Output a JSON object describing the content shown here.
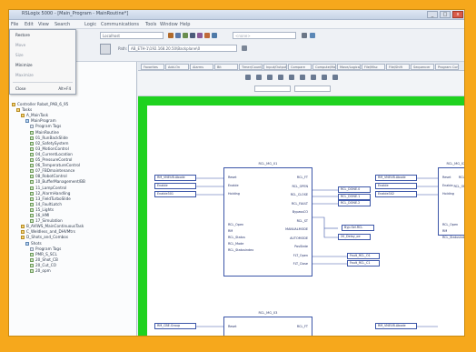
{
  "window": {
    "title": "RSLogix 5000 - [Main_Program - MainRoutine*]",
    "controls": [
      "_",
      "□",
      "x"
    ]
  },
  "menubar": {
    "items": [
      "File",
      "Edit",
      "View",
      "Search",
      "Logic",
      "Communications",
      "Tools",
      "Window",
      "Help"
    ]
  },
  "view_menu": {
    "items": [
      {
        "label": "Restore",
        "enabled": true
      },
      {
        "label": "Move",
        "enabled": false
      },
      {
        "label": "Size",
        "enabled": false
      },
      {
        "label": "Minimize",
        "enabled": true
      },
      {
        "label": "Maximize",
        "enabled": false
      },
      {
        "label": "Close",
        "enabled": true,
        "shortcut": "Alt+F4"
      }
    ]
  },
  "toolbar": {
    "combo_value": "Localhost",
    "path_value": "AB_ETH-1\\192.168.20.50\\Backplane\\0",
    "path_label": "Path:",
    "search_placeholder": "<none>"
  },
  "editor_tabs": [
    "Favorites",
    "Add-On",
    "Alarms",
    "Bit",
    "Timer/Counter",
    "Input/Output",
    "Compare",
    "Compute/Math",
    "Move/Logical",
    "File/Misc",
    "File/Shift",
    "Sequencer",
    "Program Control"
  ],
  "controller_organizer": {
    "items": [
      {
        "label": "Controller Robot_PAB_6_95",
        "indent": 0,
        "icon": "folder"
      },
      {
        "label": "Tasks",
        "indent": 1,
        "icon": "folder"
      },
      {
        "label": "A_MainTask",
        "indent": 2,
        "icon": "folder"
      },
      {
        "label": "MainProgram",
        "indent": 3,
        "icon": "prog"
      },
      {
        "label": "Program Tags",
        "indent": 4,
        "icon": "tag"
      },
      {
        "label": "MainRoutine",
        "indent": 4,
        "icon": "rout"
      },
      {
        "label": "01_RunBackSlide",
        "indent": 4,
        "icon": "rout"
      },
      {
        "label": "02_SafetySystem",
        "indent": 4,
        "icon": "rout"
      },
      {
        "label": "03_MotionControl",
        "indent": 4,
        "icon": "rout"
      },
      {
        "label": "04_CurrentLocation",
        "indent": 4,
        "icon": "rout"
      },
      {
        "label": "05_PressureControl",
        "indent": 4,
        "icon": "rout"
      },
      {
        "label": "06_TemperatureControl",
        "indent": 4,
        "icon": "rout"
      },
      {
        "label": "07_FBDmaintenance",
        "indent": 4,
        "icon": "rout"
      },
      {
        "label": "08_RobotControl",
        "indent": 4,
        "icon": "rout"
      },
      {
        "label": "10_BufferManagement/BB",
        "indent": 4,
        "icon": "rout"
      },
      {
        "label": "11_LampControl",
        "indent": 4,
        "icon": "rout"
      },
      {
        "label": "12_AlarmHandling",
        "indent": 4,
        "icon": "rout"
      },
      {
        "label": "13_FieldTurboSlide",
        "indent": 4,
        "icon": "rout"
      },
      {
        "label": "14_FaultLatch",
        "indent": 4,
        "icon": "rout"
      },
      {
        "label": "15_Lights",
        "indent": 4,
        "icon": "rout"
      },
      {
        "label": "16_HMI",
        "indent": 4,
        "icon": "rout"
      },
      {
        "label": "17_Simulation",
        "indent": 4,
        "icon": "rout"
      },
      {
        "label": "B_AVIWS_MainContinuousTask",
        "indent": 2,
        "icon": "folder"
      },
      {
        "label": "C_Weldless_and_DHVMtrs",
        "indent": 2,
        "icon": "folder"
      },
      {
        "label": "D_Shots_and_Combos",
        "indent": 2,
        "icon": "folder"
      },
      {
        "label": "Shots",
        "indent": 3,
        "icon": "prog"
      },
      {
        "label": "Program Tags",
        "indent": 4,
        "icon": "tag"
      },
      {
        "label": "PMR_S_SCL",
        "indent": 4,
        "icon": "rout"
      },
      {
        "label": "20_Shot_CB",
        "indent": 4,
        "icon": "rout"
      },
      {
        "label": "20_Cut_CO",
        "indent": 4,
        "icon": "rout"
      },
      {
        "label": "20_opm",
        "indent": 4,
        "icon": "rout"
      }
    ]
  },
  "fbd": {
    "blocks": [
      {
        "title": "RCL_MG_01",
        "inputs": [
          "Reset",
          "Enable",
          "Holding"
        ],
        "outputs": [
          "RCL_FT",
          "RCL_OPEN",
          "RCL_CLOSE",
          "RCL_FAULT",
          "BypassCO",
          "RCL_ST",
          "MANUALMODE",
          "AUTOMODE",
          "PosState",
          "FLT_Open",
          "FLT_Close"
        ],
        "left_params": [
          "RCL_Open",
          "RM",
          "RCL_Status",
          "RCL_Mode",
          "RCL_Statusindex"
        ]
      },
      {
        "title": "RCL_MG_02",
        "inputs": [
          "Reset",
          "Enable",
          "Holding"
        ],
        "outputs": [
          "RCL_FT",
          "RCL_OPEN"
        ],
        "left_params": [
          "RCL_Open",
          "RM",
          "RCL_Statusindex"
        ]
      },
      {
        "title": "RCL_MG_03",
        "inputs": [
          "Reset"
        ],
        "outputs": [
          "RCL_FT"
        ],
        "left_params": []
      }
    ],
    "input_tags_1": [
      "RM_VNEUB.Abode",
      "Enable",
      "Enable301"
    ],
    "input_tags_2": [
      "RM_VNEUB.Abode",
      "Enable",
      "Enable302"
    ],
    "output_tags": [
      "RCL_DONE.0",
      "RCL_DONE.1",
      "RCL_DONE.2"
    ],
    "aux_tags": [
      "Byp.Sel.RCL",
      "20_Delay_oe",
      "Fault_RCL_O1",
      "Fault_RCL_C1"
    ],
    "bottom_tags": [
      "RM_CBE.Group",
      "RM_VNEUB.Abode"
    ]
  }
}
